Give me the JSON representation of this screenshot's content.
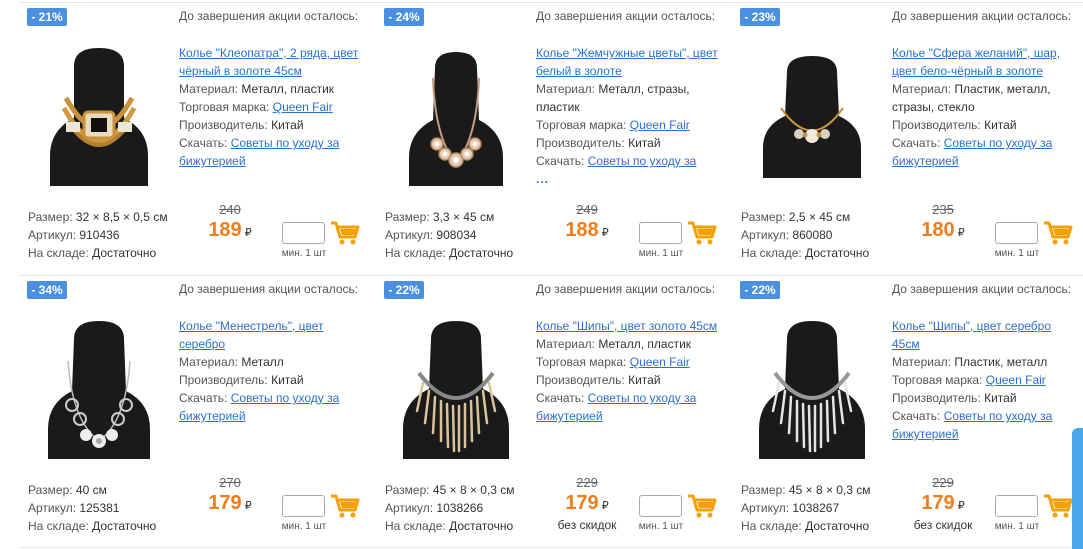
{
  "labels": {
    "timer": "До завершения акции осталось:",
    "material": "Материал:",
    "brand": "Торговая марка:",
    "producer": "Производитель:",
    "download": "Скачать:",
    "size": "Размер:",
    "article": "Артикул:",
    "stock": "На складе:",
    "min": "мин. 1 шт",
    "currency": "₽",
    "ellipsis": "..."
  },
  "products": [
    {
      "discount": "- 21%",
      "title": "Колье \"Клеопатра\", 2 ряда, цвет чёрный в золоте 45см",
      "material": "Металл, пластик",
      "brand": "Queen Fair",
      "producer": "Китай",
      "download": "Советы по уходу за бижутерией",
      "size": "32 × 8,5 × 0,5 см",
      "article": "910436",
      "stock": "Достаточно",
      "old_price": "240",
      "new_price": "189",
      "no_discount": ""
    },
    {
      "discount": "- 24%",
      "title": "Колье \"Жемчужные цветы\", цвет белый в золоте",
      "material": "Металл, стразы, пластик",
      "brand": "Queen Fair",
      "producer": "Китай",
      "download": "Советы по уходу за",
      "size": "3,3 × 45 см",
      "article": "908034",
      "stock": "Достаточно",
      "old_price": "249",
      "new_price": "188",
      "no_discount": ""
    },
    {
      "discount": "- 23%",
      "title": "Колье \"Сфера желаний\", шар, цвет бело-чёрный в золоте",
      "material": "Пластик, металл, стразы, стекло",
      "brand": "",
      "producer": "Китай",
      "download": "Советы по уходу за бижутерией",
      "size": "2,5 × 45 см",
      "article": "860080",
      "stock": "Достаточно",
      "old_price": "235",
      "new_price": "180",
      "no_discount": ""
    },
    {
      "discount": "- 34%",
      "title": "Колье \"Менестрель\", цвет серебро",
      "material": "Металл",
      "brand": "",
      "producer": "Китай",
      "download": "Советы по уходу за бижутерией",
      "size": "40 см",
      "article": "125381",
      "stock": "Достаточно",
      "old_price": "270",
      "new_price": "179",
      "no_discount": ""
    },
    {
      "discount": "- 22%",
      "title": "Колье \"Шипы\", цвет золото 45см",
      "material": "Металл, пластик",
      "brand": "Queen Fair",
      "producer": "Китай",
      "download": "Советы по уходу за бижутерией",
      "size": "45 × 8 × 0,3 см",
      "article": "1038266",
      "stock": "Достаточно",
      "old_price": "229",
      "new_price": "179",
      "no_discount": "без скидок"
    },
    {
      "discount": "- 22%",
      "title": "Колье \"Шипы\", цвет серебро 45см",
      "material": "Пластик, металл",
      "brand": "Queen Fair",
      "producer": "Китай",
      "download": "Советы по уходу за бижутерией",
      "size": "45 × 8 × 0,3 см",
      "article": "1038267",
      "stock": "Достаточно",
      "old_price": "229",
      "new_price": "179",
      "no_discount": "без скидок"
    }
  ],
  "colors": {
    "accent": "#4a8fe0",
    "price": "#f07c1a",
    "link": "#2a6fd0",
    "cart": "#f5a000"
  }
}
